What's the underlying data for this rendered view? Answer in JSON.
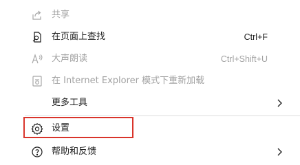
{
  "menu": {
    "items": [
      {
        "label": "共享",
        "shortcut": "",
        "icon": "share-icon",
        "disabled": true
      },
      {
        "label": "在页面上查找",
        "shortcut": "Ctrl+F",
        "icon": "find-icon",
        "disabled": false
      },
      {
        "label": "大声朗读",
        "shortcut": "Ctrl+Shift+U",
        "icon": "read-aloud-icon",
        "disabled": true
      },
      {
        "label": "在 Internet Explorer 模式下重新加载",
        "shortcut": "",
        "icon": "ie-mode-icon",
        "disabled": true
      },
      {
        "label": "更多工具",
        "shortcut": "",
        "icon": "",
        "disabled": false
      },
      {
        "label": "设置",
        "shortcut": "",
        "icon": "gear-icon",
        "disabled": false
      },
      {
        "label": "帮助和反馈",
        "shortcut": "",
        "icon": "help-icon",
        "disabled": false
      }
    ]
  },
  "colors": {
    "text": "#1b1b1b",
    "disabled_text": "#a2a2a2",
    "highlight_border": "#d9342b",
    "divider": "#dcdcdc"
  }
}
